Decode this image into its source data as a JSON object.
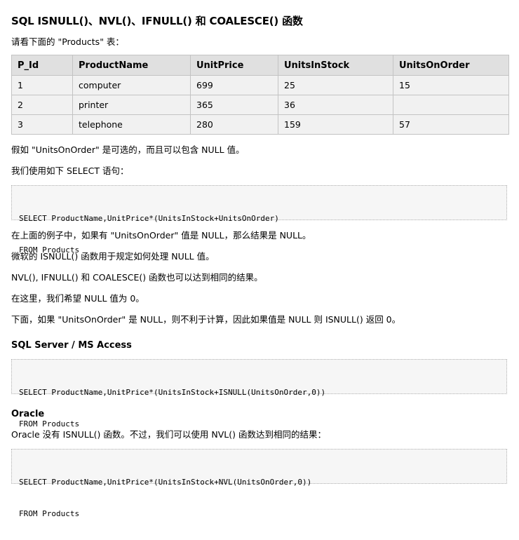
{
  "title": "SQL ISNULL()、NVL()、IFNULL() 和 COALESCE() 函数",
  "intro": "请看下面的 \"Products\" 表：",
  "table": {
    "headers": [
      "P_Id",
      "ProductName",
      "UnitPrice",
      "UnitsInStock",
      "UnitsOnOrder"
    ],
    "rows": [
      [
        "1",
        "computer",
        "699",
        "25",
        "15"
      ],
      [
        "2",
        "printer",
        "365",
        "36",
        ""
      ],
      [
        "3",
        "telephone",
        "280",
        "159",
        "57"
      ]
    ]
  },
  "para_optional": "假如 \"UnitsOnOrder\" 是可选的，而且可以包含 NULL 值。",
  "para_select": "我们使用如下 SELECT 语句：",
  "code1": {
    "line1": "SELECT ProductName,UnitPrice*(UnitsInStock+UnitsOnOrder)",
    "line2": "FROM Products"
  },
  "para_null_result": "在上面的例子中，如果有 \"UnitsOnOrder\" 值是 NULL，那么结果是 NULL。",
  "para_isnull": "微软的 ISNULL() 函数用于规定如何处理 NULL 值。",
  "para_others": "NVL(), IFNULL() 和 COALESCE() 函数也可以达到相同的结果。",
  "para_hope": "在这里，我们希望 NULL 值为 0。",
  "para_below": "下面，如果 \"UnitsOnOrder\" 是 NULL，则不利于计算，因此如果值是 NULL 则 ISNULL() 返回 0。",
  "section_sqlserver": "SQL Server / MS Access",
  "code2": {
    "line1": "SELECT ProductName,UnitPrice*(UnitsInStock+ISNULL(UnitsOnOrder,0))",
    "line2": "FROM Products"
  },
  "section_oracle": "Oracle",
  "para_oracle": "Oracle 没有 ISNULL() 函数。不过，我们可以使用 NVL() 函数达到相同的结果：",
  "code3": {
    "line1": "SELECT ProductName,UnitPrice*(UnitsInStock+NVL(UnitsOnOrder,0))",
    "line2": "FROM Products"
  }
}
